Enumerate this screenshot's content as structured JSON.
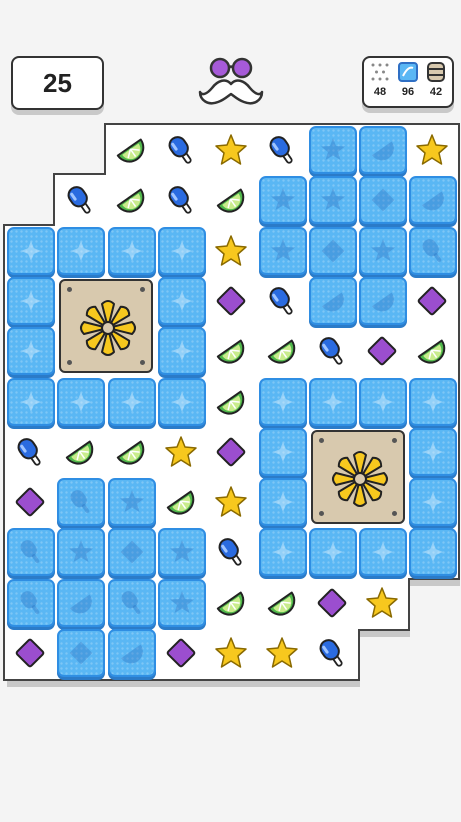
{
  "hud": {
    "moves": "25",
    "goals": [
      {
        "icon": "dotted-tile-icon",
        "count": "48"
      },
      {
        "icon": "blue-block-icon",
        "count": "96"
      },
      {
        "icon": "crate-stack-icon",
        "count": "42"
      }
    ]
  },
  "colors": {
    "block": "#5ab7f4",
    "block_border": "#2f8ee3",
    "star": "#f7c81e",
    "gem": "#9b4ecf",
    "popsicle": "#2a6be0",
    "lime": "#4fb84b",
    "crate": "#d8c9ae",
    "flower": "#f7c81e"
  },
  "board": {
    "pieces": [
      [
        null,
        null,
        "lime",
        "popsicle",
        "star",
        "popsicle",
        "star",
        "lime",
        "star"
      ],
      [
        null,
        "popsicle",
        "lime",
        "popsicle",
        "lime",
        "star",
        "star",
        "diamond",
        "lime"
      ],
      [
        null,
        null,
        null,
        null,
        "star",
        "star",
        "diamond",
        "star",
        "popsicle"
      ],
      [
        null,
        null,
        null,
        null,
        "diamond",
        "popsicle",
        "lime",
        "lime",
        "diamond"
      ],
      [
        null,
        null,
        null,
        null,
        "lime",
        "lime",
        "popsicle",
        "diamond",
        "lime"
      ],
      [
        null,
        null,
        null,
        null,
        "lime",
        null,
        null,
        null,
        null
      ],
      [
        "popsicle",
        "lime",
        "lime",
        "star",
        "diamond",
        null,
        null,
        null,
        null
      ],
      [
        "diamond",
        "popsicle",
        "star",
        "lime",
        "star",
        null,
        null,
        null,
        null
      ],
      [
        "popsicle",
        "star",
        "diamond",
        "star",
        "popsicle",
        null,
        null,
        null,
        null
      ],
      [
        "popsicle",
        "lime",
        "popsicle",
        "star",
        "lime",
        "lime",
        "diamond",
        "star",
        null
      ],
      [
        "diamond",
        "diamond",
        "lime",
        "diamond",
        "star",
        "star",
        "popsicle",
        null,
        null
      ]
    ],
    "blocked": [
      [
        0,
        6
      ],
      [
        0,
        7
      ],
      [
        1,
        5
      ],
      [
        1,
        6
      ],
      [
        1,
        7
      ],
      [
        1,
        8
      ],
      [
        2,
        0
      ],
      [
        2,
        1
      ],
      [
        2,
        2
      ],
      [
        2,
        3
      ],
      [
        2,
        5
      ],
      [
        2,
        6
      ],
      [
        2,
        7
      ],
      [
        2,
        8
      ],
      [
        3,
        0
      ],
      [
        3,
        3
      ],
      [
        3,
        6
      ],
      [
        3,
        7
      ],
      [
        4,
        0
      ],
      [
        4,
        3
      ],
      [
        5,
        0
      ],
      [
        5,
        1
      ],
      [
        5,
        2
      ],
      [
        5,
        3
      ],
      [
        5,
        5
      ],
      [
        5,
        6
      ],
      [
        5,
        7
      ],
      [
        5,
        8
      ],
      [
        6,
        5
      ],
      [
        6,
        8
      ],
      [
        7,
        1
      ],
      [
        7,
        2
      ],
      [
        7,
        5
      ],
      [
        7,
        8
      ],
      [
        8,
        0
      ],
      [
        8,
        1
      ],
      [
        8,
        2
      ],
      [
        8,
        3
      ],
      [
        8,
        5
      ],
      [
        8,
        6
      ],
      [
        8,
        7
      ],
      [
        8,
        8
      ],
      [
        9,
        0
      ],
      [
        9,
        1
      ],
      [
        9,
        2
      ],
      [
        9,
        3
      ],
      [
        10,
        1
      ],
      [
        10,
        2
      ]
    ],
    "crates": [
      [
        3,
        1
      ],
      [
        6,
        6
      ]
    ]
  }
}
